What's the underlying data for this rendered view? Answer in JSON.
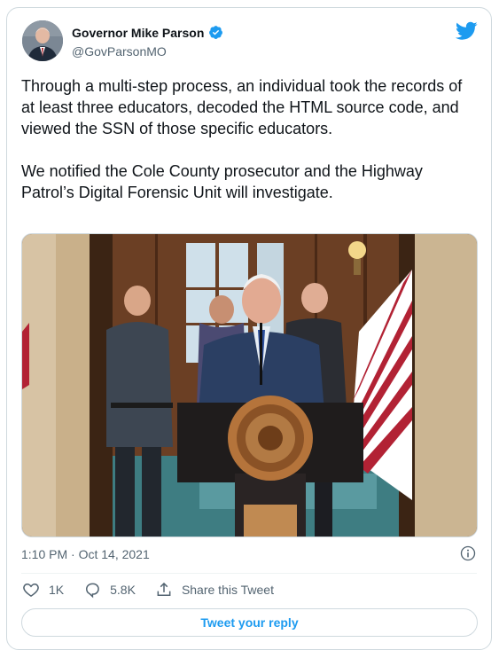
{
  "author": {
    "name": "Governor Mike Parson",
    "handle": "@GovParsonMO"
  },
  "tweet": {
    "paragraphs": [
      "Through a multi-step process, an individual took the records of at least three educators, decoded the HTML source code, and viewed the SSN of those specific educators.",
      "We notified the Cole County prosecutor and the Highway Patrol’s Digital Forensic Unit will investigate."
    ],
    "timestamp": "1:10 PM · Oct 14, 2021"
  },
  "actions": {
    "likes": "1K",
    "replies": "5.8K",
    "share_label": "Share this Tweet",
    "reply_button": "Tweet your reply"
  },
  "icons": {
    "brand": "twitter-bird-icon",
    "verified": "verified-badge-icon",
    "like": "heart-icon",
    "reply": "reply-bubble-icon",
    "share": "share-icon",
    "info": "info-icon"
  },
  "colors": {
    "accent": "#1d9bf0",
    "text": "#0f1419",
    "muted": "#536471",
    "border": "#cfd9de"
  }
}
